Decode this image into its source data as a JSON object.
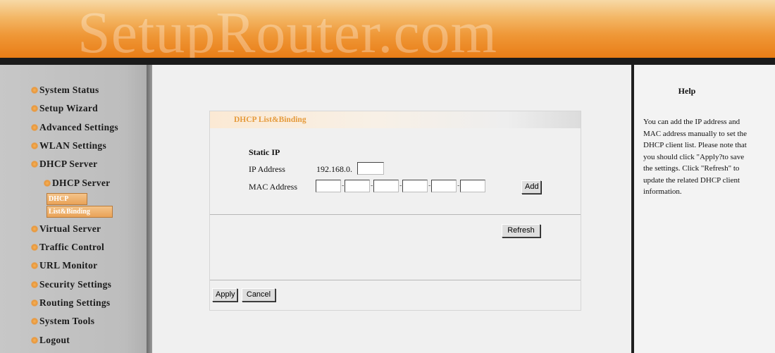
{
  "watermark": "SetupRouter.com",
  "sidebar": {
    "items": [
      {
        "label": "System Status"
      },
      {
        "label": "Setup Wizard"
      },
      {
        "label": "Advanced Settings"
      },
      {
        "label": "WLAN Settings"
      },
      {
        "label": "DHCP Server"
      },
      {
        "label": "DHCP Server"
      },
      {
        "label": "Virtual Server"
      },
      {
        "label": "Traffic Control"
      },
      {
        "label": "URL Monitor"
      },
      {
        "label": "Security Settings"
      },
      {
        "label": "Routing Settings"
      },
      {
        "label": "System Tools"
      },
      {
        "label": "Logout"
      }
    ],
    "selected_1": "DHCP",
    "selected_2": "List&Binding"
  },
  "panel": {
    "title": "DHCP List&Binding",
    "section_label": "Static IP",
    "ip_label": "IP Address",
    "ip_prefix": "192.168.0.",
    "ip_value": "",
    "mac_label": "MAC Address",
    "mac_values": [
      "",
      "",
      "",
      "",
      "",
      ""
    ],
    "add_label": "Add",
    "refresh_label": "Refresh",
    "apply_label": "Apply",
    "cancel_label": "Cancel"
  },
  "help": {
    "title": "Help",
    "text": "You can add the IP address and MAC address manually to set the DHCP client list. Please note that you should click \"Apply?to save the settings. Click \"Refresh\" to update the related DHCP client information."
  }
}
